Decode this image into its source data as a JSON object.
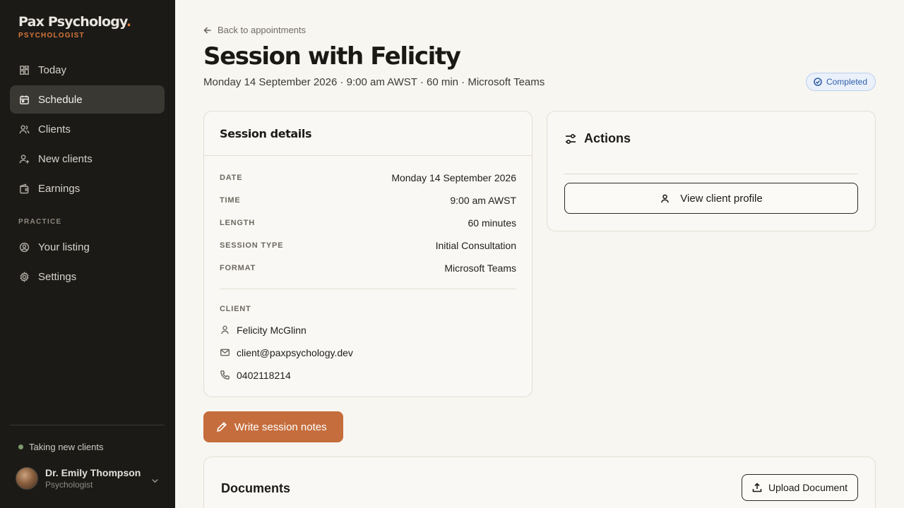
{
  "brand": {
    "name": "Pax Psychology",
    "dot": ".",
    "role": "PSYCHOLOGIST"
  },
  "sidebar": {
    "items": [
      {
        "label": "Today",
        "icon": "dashboard-icon"
      },
      {
        "label": "Schedule",
        "icon": "calendar-icon",
        "active": true
      },
      {
        "label": "Clients",
        "icon": "users-icon"
      },
      {
        "label": "New clients",
        "icon": "user-plus-icon"
      },
      {
        "label": "Earnings",
        "icon": "wallet-icon"
      }
    ],
    "section_label": "PRACTICE",
    "practice_items": [
      {
        "label": "Your listing",
        "icon": "user-circle-icon"
      },
      {
        "label": "Settings",
        "icon": "gear-icon"
      }
    ],
    "status": "Taking new clients",
    "user": {
      "name": "Dr. Emily Thompson",
      "role": "Psychologist"
    }
  },
  "page": {
    "back_label": "Back to appointments",
    "title": "Session with Felicity",
    "subtitle": "Monday 14 September 2026 · 9:00 am AWST · 60 min · Microsoft Teams",
    "status_badge": "Completed"
  },
  "details": {
    "heading": "Session details",
    "rows": [
      {
        "label": "DATE",
        "value": "Monday 14 September 2026"
      },
      {
        "label": "TIME",
        "value": "9:00 am AWST"
      },
      {
        "label": "LENGTH",
        "value": "60 minutes"
      },
      {
        "label": "SESSION TYPE",
        "value": "Initial Consultation"
      },
      {
        "label": "FORMAT",
        "value": "Microsoft Teams"
      }
    ],
    "client_label": "CLIENT",
    "client": {
      "name": "Felicity McGlinn",
      "email": "client@paxpsychology.dev",
      "phone": "0402118214"
    }
  },
  "actions": {
    "heading": "Actions",
    "view_profile": "View client profile"
  },
  "notes_button": "Write session notes",
  "documents": {
    "heading": "Documents",
    "upload": "Upload Document"
  },
  "colors": {
    "accent": "#c56d3c",
    "sidebar_bg": "#1b1a17",
    "badge": "#2f5fa8"
  }
}
